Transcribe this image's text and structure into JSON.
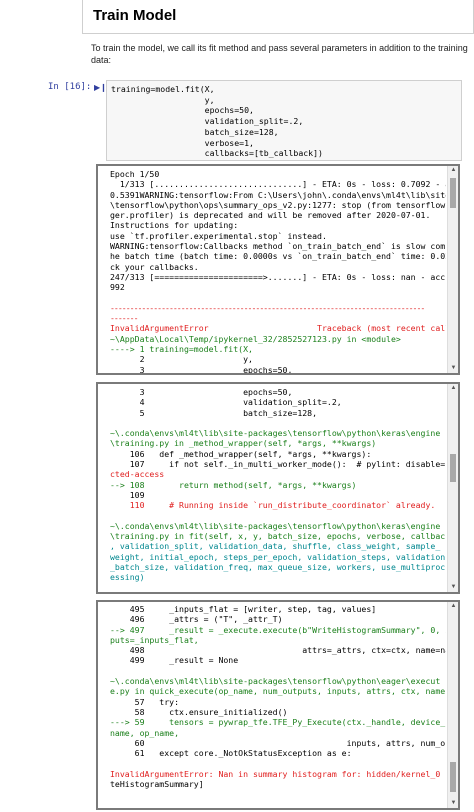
{
  "heading": "Train Model",
  "description": "To train the model, we call its fit method and pass several parameters in addition to the training data:",
  "cell": {
    "prompt": "In [16]:",
    "code_lines": [
      "training=model.fit(X,",
      "                   y,",
      "                   epochs=50,",
      "                   validation_split=.2,",
      "                   batch_size=128,",
      "                   verbose=1,",
      "                   callbacks=[tb_callback])"
    ]
  },
  "output_1": [
    {
      "t": "Epoch 1/50",
      "c": ""
    },
    {
      "t": "  1/313 [..............................] - ETA: 0s - loss: 0.7092 - accuracy:",
      "c": ""
    },
    {
      "t": "0.5391WARNING:tensorflow:From C:\\Users\\john\\.conda\\envs\\ml4t\\lib\\site-packages",
      "c": ""
    },
    {
      "t": "\\tensorflow\\python\\ops\\summary_ops_v2.py:1277: stop (from tensorflow.python.ea",
      "c": ""
    },
    {
      "t": "ger.profiler) is deprecated and will be removed after 2020-07-01.",
      "c": ""
    },
    {
      "t": "Instructions for updating:",
      "c": ""
    },
    {
      "t": "use `tf.profiler.experimental.stop` instead.",
      "c": ""
    },
    {
      "t": "WARNING:tensorflow:Callbacks method `on_train_batch_end` is slow compared to t",
      "c": ""
    },
    {
      "t": "he batch time (batch time: 0.0000s vs `on_train_batch_end` time: 0.0208s). Che",
      "c": ""
    },
    {
      "t": "ck your callbacks.",
      "c": ""
    },
    {
      "t": "247/313 [======================>.......] - ETA: 0s - loss: nan - accuracy: 0.4",
      "c": ""
    },
    {
      "t": "992",
      "c": ""
    },
    {
      "t": "",
      "c": ""
    },
    {
      "t": "--------------------------------------------------------------------------------",
      "c": "dash"
    },
    {
      "t": "-------",
      "c": "dash"
    },
    {
      "t": "InvalidArgumentError                      Traceback (most recent call last)",
      "c": "red"
    },
    {
      "t": "~\\AppData\\Local\\Temp/ipykernel_32/2852527123.py in <module>",
      "c": "grn"
    },
    {
      "t": "----> 1 training=model.fit(X,",
      "c": "grn"
    },
    {
      "t": "      2                    y,",
      "c": ""
    },
    {
      "t": "      3                    epochs=50,",
      "c": ""
    }
  ],
  "output_2": [
    {
      "t": "      3                    epochs=50,",
      "c": ""
    },
    {
      "t": "      4                    validation_split=.2,",
      "c": ""
    },
    {
      "t": "      5                    batch_size=128,",
      "c": ""
    },
    {
      "t": "",
      "c": ""
    },
    {
      "t": "~\\.conda\\envs\\ml4t\\lib\\site-packages\\tensorflow\\python\\keras\\engine",
      "c": "grn"
    },
    {
      "t": "\\training.py in _method_wrapper(self, *args, **kwargs)",
      "c": "grn"
    },
    {
      "t": "    106   def _method_wrapper(self, *args, **kwargs):",
      "c": ""
    },
    {
      "t": "    107     if not self._in_multi_worker_mode():  # pylint: disable=prote",
      "c": ""
    },
    {
      "t": "cted-access",
      "c": "red"
    },
    {
      "t": "--> 108       return method(self, *args, **kwargs)",
      "c": "grn"
    },
    {
      "t": "    109",
      "c": ""
    },
    {
      "t": "    110     # Running inside `run_distribute_coordinator` already.",
      "c": "red"
    },
    {
      "t": "",
      "c": ""
    },
    {
      "t": "~\\.conda\\envs\\ml4t\\lib\\site-packages\\tensorflow\\python\\keras\\engine",
      "c": "grn"
    },
    {
      "t": "\\training.py in fit(self, x, y, batch_size, epochs, verbose, callbacks",
      "c": "grn"
    },
    {
      "t": ", validation_split, validation_data, shuffle, class_weight, sample_",
      "c": "cyn"
    },
    {
      "t": "weight, initial_epoch, steps_per_epoch, validation_steps, validation",
      "c": "cyn"
    },
    {
      "t": "_batch_size, validation_freq, max_queue_size, workers, use_multiproc",
      "c": "cyn"
    },
    {
      "t": "essing)",
      "c": "cyn"
    },
    {
      "t": "",
      "c": ""
    }
  ],
  "output_3": [
    {
      "t": "    495     _inputs_flat = [writer, step, tag, values]",
      "c": ""
    },
    {
      "t": "    496     _attrs = (\"T\", _attr_T)",
      "c": ""
    },
    {
      "t": "--> 497     _result = _execute.execute(b\"WriteHistogramSummary\", 0, in",
      "c": "grn"
    },
    {
      "t": "puts=_inputs_flat,",
      "c": "grn"
    },
    {
      "t": "    498                                attrs=_attrs, ctx=ctx, name=name)",
      "c": ""
    },
    {
      "t": "    499     _result = None",
      "c": ""
    },
    {
      "t": "",
      "c": ""
    },
    {
      "t": "~\\.conda\\envs\\ml4t\\lib\\site-packages\\tensorflow\\python\\eager\\execut",
      "c": "grn"
    },
    {
      "t": "e.py in quick_execute(op_name, num_outputs, inputs, attrs, ctx, name)",
      "c": "grn"
    },
    {
      "t": "     57   try:",
      "c": ""
    },
    {
      "t": "     58     ctx.ensure_initialized()",
      "c": ""
    },
    {
      "t": "---> 59     tensors = pywrap_tfe.TFE_Py_Execute(ctx._handle, device_",
      "c": "grn"
    },
    {
      "t": "name, op_name,",
      "c": "grn"
    },
    {
      "t": "     60                                         inputs, attrs, num_outputs)",
      "c": ""
    },
    {
      "t": "     61   except core._NotOkStatusException as e:",
      "c": ""
    },
    {
      "t": "",
      "c": ""
    },
    {
      "t": "InvalidArgumentError: Nan in summary histogram for: hidden/kernel_0 [Op:Wri",
      "c": "red"
    },
    {
      "t": "teHistogramSummary]",
      "c": ""
    }
  ],
  "colors": {
    "error_red": "#e02020",
    "trace_green": "#1a7f1a",
    "args_cyan": "#00878f",
    "prompt_blue": "#303f9f"
  }
}
